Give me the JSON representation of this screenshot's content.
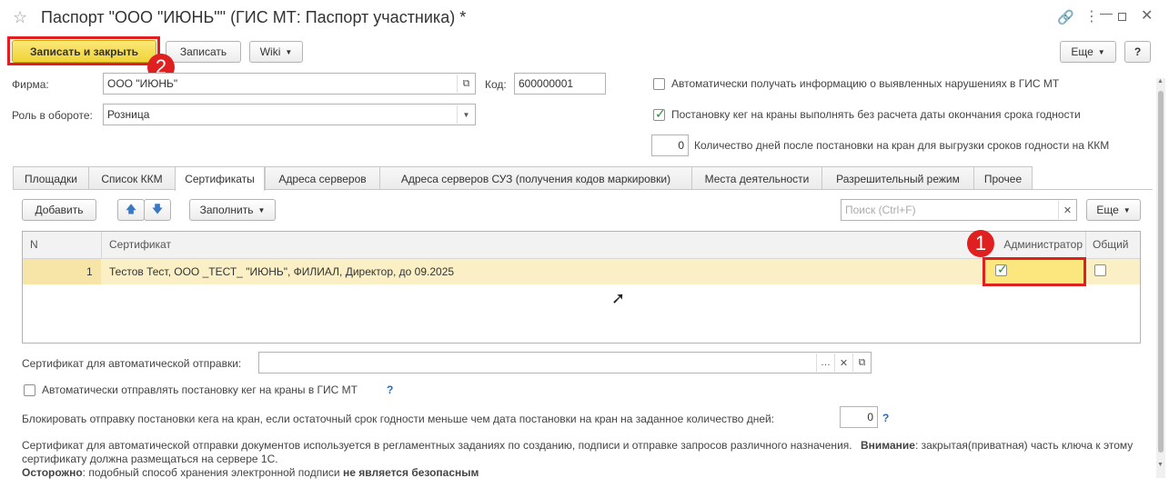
{
  "window": {
    "title": "Паспорт \"ООО \"ИЮНЬ\"\" (ГИС МТ: Паспорт участника) *"
  },
  "toolbar": {
    "save_close_label": "Записать и закрыть",
    "save_label": "Записать",
    "wiki_label": "Wiki",
    "more_label": "Еще",
    "help_label": "?"
  },
  "form": {
    "firma_label": "Фирма:",
    "firma_value": "ООО \"ИЮНЬ\"",
    "kod_label": "Код:",
    "kod_value": "600000001",
    "role_label": "Роль в обороте:",
    "role_value": "Розница",
    "auto_violations_label": "Автоматически получать информацию о выявленных нарушениях в ГИС МТ",
    "auto_violations_checked": false,
    "keg_no_expiry_label": "Постановку кег на краны выполнять без расчета даты окончания срока годности",
    "keg_no_expiry_checked": true,
    "days_value": "0",
    "days_label": "Количество дней после постановки на кран для выгрузки сроков годности на ККМ"
  },
  "tabs": [
    {
      "label": "Площадки",
      "active": false
    },
    {
      "label": "Список ККМ",
      "active": false
    },
    {
      "label": "Сертификаты",
      "active": true
    },
    {
      "label": "Адреса серверов",
      "active": false
    },
    {
      "label": "Адреса серверов СУЗ (получения кодов маркировки)",
      "active": false
    },
    {
      "label": "Места деятельности",
      "active": false
    },
    {
      "label": "Разрешительный режим",
      "active": false
    },
    {
      "label": "Прочее",
      "active": false
    }
  ],
  "cert_toolbar": {
    "add_label": "Добавить",
    "fill_label": "Заполнить",
    "search_placeholder": "Поиск (Ctrl+F)",
    "more_label": "Еще"
  },
  "table": {
    "columns": [
      "N",
      "Сертификат",
      "Администратор",
      "Общий"
    ],
    "rows": [
      {
        "n": "1",
        "cert": "Тестов Тест, ООО _ТЕСТ_ \"ИЮНЬ\", ФИЛИАЛ, Директор, до 09.2025",
        "admin": true,
        "common": false
      }
    ]
  },
  "bottom": {
    "auto_cert_label": "Сертификат для автоматической отправки:",
    "auto_cert_value": "",
    "auto_keg_label": "Автоматически отправлять постановку кег на краны в ГИС МТ",
    "auto_keg_checked": false,
    "help_q": "?",
    "block_label": "Блокировать отправку постановки кега на кран, если остаточный срок годности меньше чем дата постановки на кран на заданное количество дней:",
    "block_value": "0",
    "info_text_1": "Сертификат для автоматической отправки документов используется в регламентных заданиях по созданию, подписи и отправке запросов различного назначения.",
    "info_attention": "Внимание",
    "info_text_2": ": закрытая(приватная) часть ключа к этому сертификату должна размещаться на сервере 1С.",
    "info_careful": "Осторожно",
    "info_text_3": ": подобный способ хранения электронной подписи",
    "info_not_safe": "не является безопасным"
  },
  "markers": {
    "one": "1",
    "two": "2"
  },
  "colors": {
    "accent_yellow": "#f1d337",
    "highlight_red": "#e02020",
    "row_yellow": "#fbf0c5"
  }
}
